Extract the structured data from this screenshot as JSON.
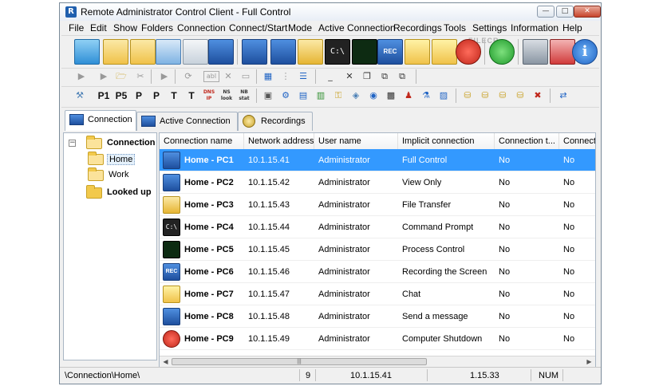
{
  "window": {
    "title": "Remote Administrator Control Client - Full Control",
    "app_icon_letter": "R",
    "controls": {
      "minimize": "—",
      "maximize": "□",
      "close": "✕"
    }
  },
  "menu": [
    "File",
    "Edit",
    "Show",
    "Folders",
    "Connection",
    "Connect/Start",
    "Mode",
    "Active Connection",
    "Recordings",
    "Tools",
    "Settings",
    "Information",
    "Help"
  ],
  "watermark": "FILECR",
  "toolbar_main": [
    {
      "icon": "connect-icon"
    },
    {
      "icon": "connect-2-icon"
    },
    {
      "icon": "connect-3-icon"
    },
    {
      "icon": "scan-icon"
    },
    {
      "icon": "document-icon"
    },
    {
      "icon": "settings-monitor-icon"
    },
    {
      "icon": "full-control-monitor-icon"
    },
    {
      "icon": "view-only-monitor-icon"
    },
    {
      "icon": "file-transfer-icon"
    },
    {
      "icon": "command-prompt-icon"
    },
    {
      "icon": "process-control-icon"
    },
    {
      "icon": "record-screen-icon"
    },
    {
      "icon": "chat-icon"
    },
    {
      "icon": "send-message-icon"
    },
    {
      "icon": "shutdown-icon"
    },
    {
      "icon": "power-on-icon"
    },
    {
      "icon": "disconnect-icon"
    },
    {
      "icon": "close-connection-icon"
    },
    {
      "icon": "info-icon"
    }
  ],
  "toolbar_secondary": {
    "rec_badge": "REC",
    "cmd_badge": "C:\\",
    "info_glyph": "i",
    "text_buttons": [
      "P1",
      "P5",
      "P",
      "P",
      "T",
      "T"
    ],
    "label_buttons": [
      "DNS IP",
      "NS look",
      "NB stat"
    ],
    "abl_label": "abl"
  },
  "tabs": [
    {
      "label": "Connection",
      "active": true
    },
    {
      "label": "Active Connection",
      "active": false
    },
    {
      "label": "Recordings",
      "active": false
    }
  ],
  "tree": [
    {
      "label": "Connection",
      "level": 0,
      "bold": true,
      "expanded": true
    },
    {
      "label": "Home",
      "level": 1,
      "bold": false,
      "selected": true
    },
    {
      "label": "Work",
      "level": 1,
      "bold": false
    },
    {
      "label": "Looked up",
      "level": 0,
      "bold": true
    }
  ],
  "columns": [
    "Connection name",
    "Network address",
    "User name",
    "Implicit connection",
    "Connection t...",
    "Connecti"
  ],
  "rows": [
    {
      "name": "Home - PC1",
      "address": "10.1.15.41",
      "user": "Administrator",
      "implicit": "Full Control",
      "c5": "No",
      "c6": "No",
      "icon": "full-control-monitor-icon",
      "selected": true
    },
    {
      "name": "Home - PC2",
      "address": "10.1.15.42",
      "user": "Administrator",
      "implicit": "View Only",
      "c5": "No",
      "c6": "No",
      "icon": "view-only-monitor-icon"
    },
    {
      "name": "Home - PC3",
      "address": "10.1.15.43",
      "user": "Administrator",
      "implicit": "File Transfer",
      "c5": "No",
      "c6": "No",
      "icon": "file-transfer-icon"
    },
    {
      "name": "Home - PC4",
      "address": "10.1.15.44",
      "user": "Administrator",
      "implicit": "Command Prompt",
      "c5": "No",
      "c6": "No",
      "icon": "command-prompt-icon"
    },
    {
      "name": "Home - PC5",
      "address": "10.1.15.45",
      "user": "Administrator",
      "implicit": "Process Control",
      "c5": "No",
      "c6": "No",
      "icon": "process-control-icon"
    },
    {
      "name": "Home - PC6",
      "address": "10.1.15.46",
      "user": "Administrator",
      "implicit": "Recording the Screen",
      "c5": "No",
      "c6": "No",
      "icon": "record-screen-icon"
    },
    {
      "name": "Home - PC7",
      "address": "10.1.15.47",
      "user": "Administrator",
      "implicit": "Chat",
      "c5": "No",
      "c6": "No",
      "icon": "chat-icon"
    },
    {
      "name": "Home - PC8",
      "address": "10.1.15.48",
      "user": "Administrator",
      "implicit": "Send a message",
      "c5": "No",
      "c6": "No",
      "icon": "send-message-icon"
    },
    {
      "name": "Home - PC9",
      "address": "10.1.15.49",
      "user": "Administrator",
      "implicit": "Computer Shutdown",
      "c5": "No",
      "c6": "No",
      "icon": "shutdown-icon"
    }
  ],
  "scrollbar": {
    "left_arrow": "◀",
    "right_arrow": "▶",
    "grip": "|||"
  },
  "status": {
    "path": "\\Connection\\Home\\",
    "count": "9",
    "address": "10.1.15.41",
    "version": "1.15.33",
    "num": "NUM"
  },
  "colors": {
    "selection": "#3399ff",
    "monitor_blue": "#1e63c4",
    "folder": "#f2c94c"
  }
}
